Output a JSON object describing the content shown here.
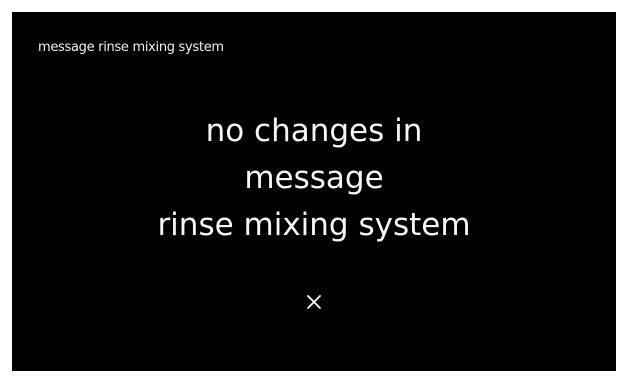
{
  "screen": {
    "title": "message rinse mixing system",
    "message_lines": [
      "no changes in",
      "message",
      "rinse mixing system"
    ],
    "close_icon": "close-icon",
    "colors": {
      "background": "#000000",
      "text": "#ffffff",
      "frame": "#ffffff"
    }
  }
}
